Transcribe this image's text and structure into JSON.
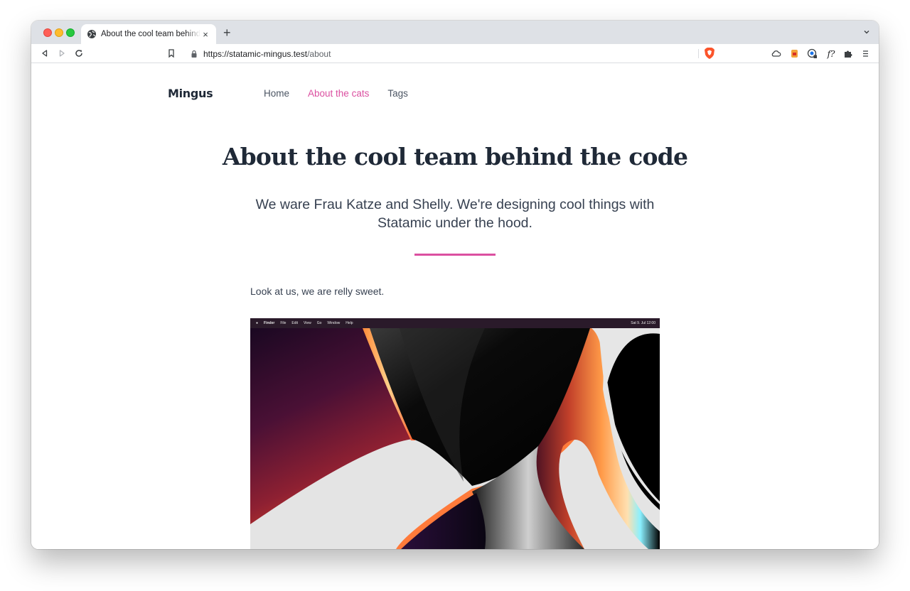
{
  "browser": {
    "tab_title": "About the cool team behind the code",
    "tab_close": "×",
    "new_tab": "+",
    "url_host": "https://statamic-mingus.test",
    "url_path": "/about",
    "ext_f_label": "f?"
  },
  "site": {
    "logo": "Mingus",
    "nav": [
      {
        "label": "Home",
        "active": false
      },
      {
        "label": "About the cats",
        "active": true
      },
      {
        "label": "Tags",
        "active": false
      }
    ],
    "accent": "#db4fa0"
  },
  "content": {
    "title": "About the cool team behind the code",
    "subtitle": "We ware Frau Katze and Shelly. We're designing cool things with Statamic under the hood.",
    "body": "Look at us, we are relly sweet."
  },
  "screenshot": {
    "menubar": [
      "Finder",
      "File",
      "Edit",
      "View",
      "Go",
      "Window",
      "Help"
    ],
    "clock": "Sat 9. Jul 12:00"
  }
}
